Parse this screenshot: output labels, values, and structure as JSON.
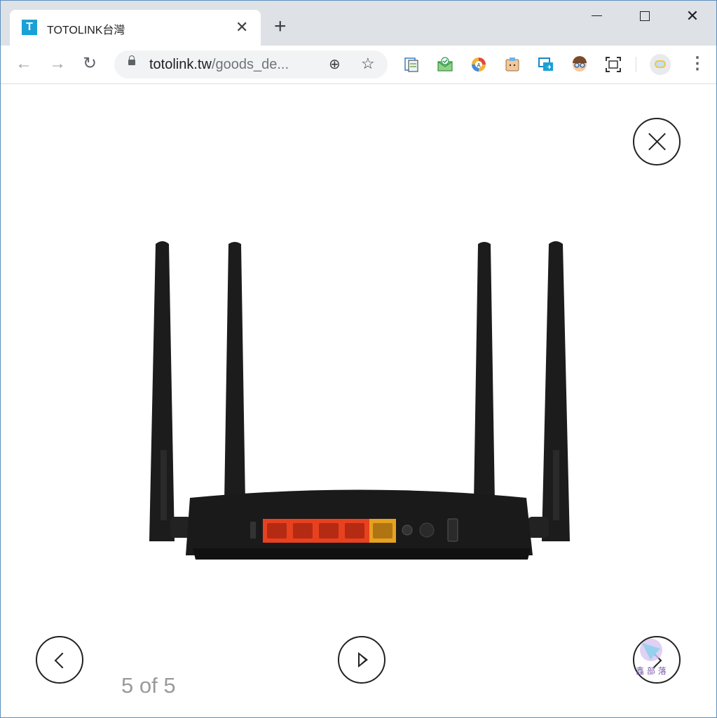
{
  "browser": {
    "tab": {
      "favicon_letter": "T",
      "title": "TOTOLINK台灣",
      "close_glyph": "✕"
    },
    "new_tab_glyph": "+",
    "window_controls": {
      "close_glyph": "✕"
    },
    "nav": {
      "back_glyph": "←",
      "forward_glyph": "→",
      "reload_glyph": "↻"
    },
    "omnibox": {
      "domain": "totolink.tw",
      "path": "/goods_de...",
      "zoom_glyph": "⊕",
      "star_glyph": "☆"
    },
    "extensions": [
      "notes-icon",
      "mail-check-icon",
      "shield-a-icon",
      "clipboard-face-icon",
      "screen-share-icon",
      "face-glasses-icon",
      "screenshot-frame-icon"
    ],
    "menu_glyph": "⋮"
  },
  "lightbox": {
    "counter": "5 of 5",
    "image": "router-rear-view",
    "controls": [
      "close-icon",
      "prev-icon",
      "play-icon",
      "next-icon"
    ],
    "watermark_text": "鑫 部 落"
  },
  "colors": {
    "accent": "#1aa1d5",
    "lan_port": "#e8411f",
    "wan_port": "#e6a120",
    "router_body": "#1a1a1a"
  }
}
